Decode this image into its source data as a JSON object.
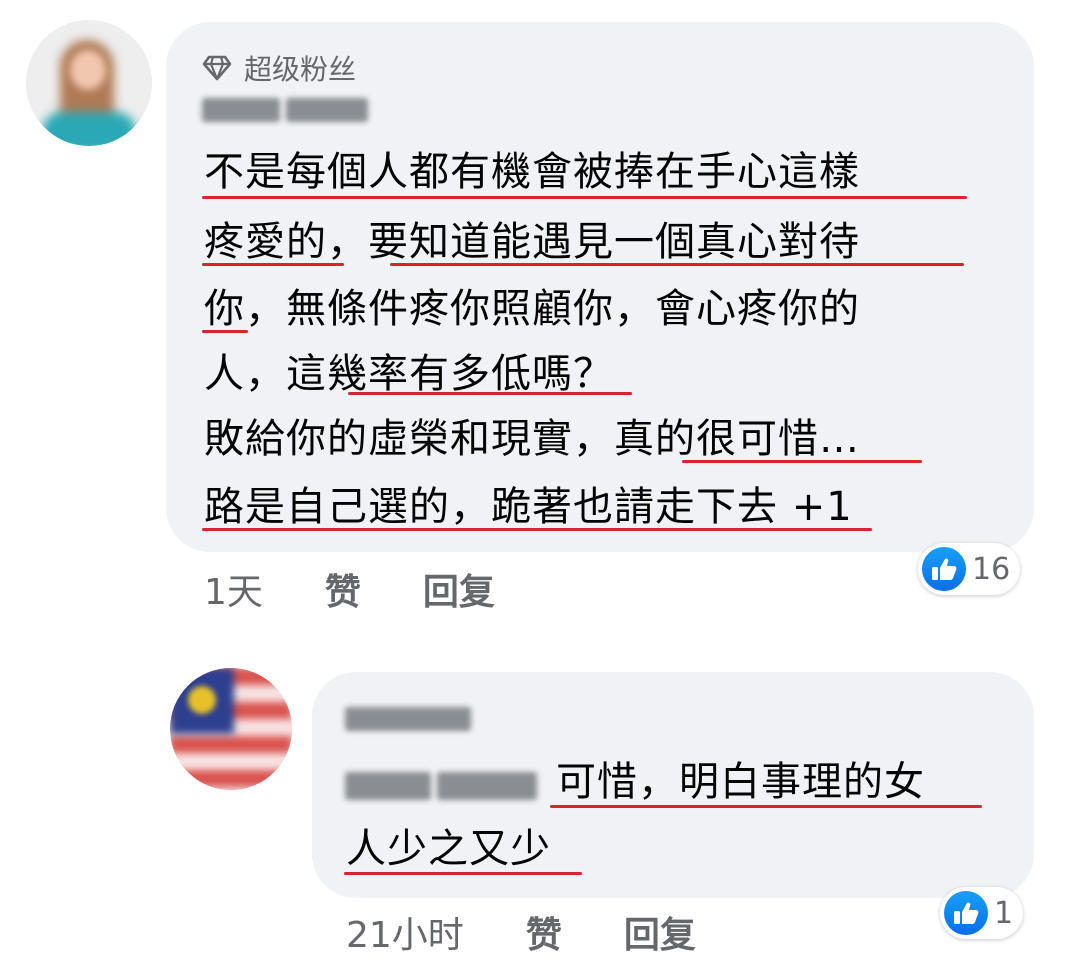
{
  "comments": [
    {
      "badge_label": "超级粉丝",
      "author": "Jess Lim",
      "body_lines": [
        "不是每個人都有機會被捧在手心這樣",
        "疼愛的，要知道能遇見一個真心對待",
        "你，無條件疼你照顧你，會心疼你的",
        "人，這幾率有多低嗎？",
        "敗給你的虛榮和現實，真的很可惜…",
        "路是自己選的，跪著也請走下去 +1"
      ],
      "time": "1天",
      "like_label": "赞",
      "reply_label": "回复",
      "reaction_icon": "thumbs-up-icon",
      "reaction_count": "16"
    },
    {
      "author": "Yvonne",
      "mention": "Jess Lim",
      "body_lines": [
        "可惜，明白事理的女",
        "人少之又少"
      ],
      "time": "21小时",
      "like_label": "赞",
      "reply_label": "回复",
      "reaction_icon": "thumbs-up-icon",
      "reaction_count": "1"
    }
  ],
  "colors": {
    "bubble": "#f0f2f5",
    "underline": "#d9232e",
    "meta_text": "#65676b",
    "like_blue": "#0a6ee8"
  }
}
